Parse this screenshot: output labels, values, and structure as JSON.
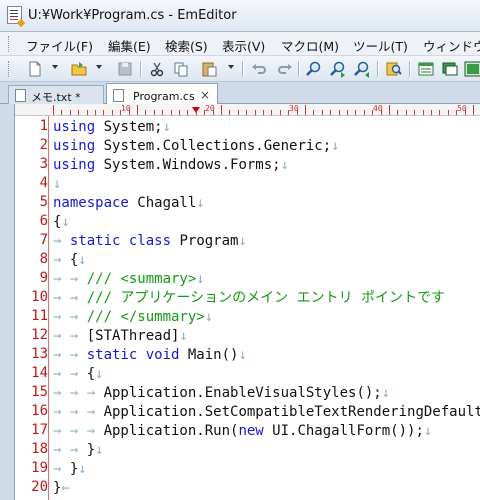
{
  "window": {
    "title": "U:¥Work¥Program.cs - EmEditor"
  },
  "menu": [
    "ファイル(F)",
    "編集(E)",
    "検索(S)",
    "表示(V)",
    "マクロ(M)",
    "ツール(T)",
    "ウィンドウ"
  ],
  "tabs": [
    {
      "label": "メモ.txt *",
      "active": false
    },
    {
      "label": "Program.cs",
      "active": true,
      "close_glyph": "×"
    }
  ],
  "ruler": {
    "labels": [
      "10",
      "20",
      "30",
      "40",
      "50"
    ]
  },
  "editor": {
    "line_numbers": [
      "1",
      "2",
      "3",
      "4",
      "5",
      "6",
      "7",
      "8",
      "9",
      "10",
      "11",
      "12",
      "13",
      "14",
      "15",
      "16",
      "17",
      "18",
      "19",
      "20"
    ],
    "lines": [
      [
        [
          "kw",
          "using"
        ],
        [
          "t",
          " System;"
        ],
        [
          "mk",
          "↓"
        ]
      ],
      [
        [
          "kw",
          "using"
        ],
        [
          "t",
          " System.Collections.Generic;"
        ],
        [
          "mk",
          "↓"
        ]
      ],
      [
        [
          "kw",
          "using"
        ],
        [
          "t",
          " System.Windows.Forms;"
        ],
        [
          "mk",
          "↓"
        ]
      ],
      [
        [
          "mk",
          "↓"
        ]
      ],
      [
        [
          "kw",
          "namespace"
        ],
        [
          "t",
          " Chagall"
        ],
        [
          "mk",
          "↓"
        ]
      ],
      [
        [
          "t",
          "{"
        ],
        [
          "mk",
          "↓"
        ]
      ],
      [
        [
          "mk",
          "→ "
        ],
        [
          "kw",
          "static"
        ],
        [
          "t",
          " "
        ],
        [
          "kw",
          "class"
        ],
        [
          "t",
          " Program"
        ],
        [
          "mk",
          "↓"
        ]
      ],
      [
        [
          "mk",
          "→ "
        ],
        [
          "t",
          "{"
        ],
        [
          "mk",
          "↓"
        ]
      ],
      [
        [
          "mk",
          "→ → "
        ],
        [
          "cm",
          "/// <summary>"
        ],
        [
          "mk",
          "↓"
        ]
      ],
      [
        [
          "mk",
          "→ → "
        ],
        [
          "cm",
          "/// アプリケーションのメイン エントリ ポイントです"
        ]
      ],
      [
        [
          "mk",
          "→ → "
        ],
        [
          "cm",
          "/// </summary>"
        ],
        [
          "mk",
          "↓"
        ]
      ],
      [
        [
          "mk",
          "→ → "
        ],
        [
          "t",
          "[STAThread]"
        ],
        [
          "mk",
          "↓"
        ]
      ],
      [
        [
          "mk",
          "→ → "
        ],
        [
          "kw",
          "static"
        ],
        [
          "t",
          " "
        ],
        [
          "kw",
          "void"
        ],
        [
          "t",
          " Main()"
        ],
        [
          "mk",
          "↓"
        ]
      ],
      [
        [
          "mk",
          "→ → "
        ],
        [
          "t",
          "{"
        ],
        [
          "mk",
          "↓"
        ]
      ],
      [
        [
          "mk",
          "→ → → "
        ],
        [
          "t",
          "Application.EnableVisualStyles();"
        ],
        [
          "mk",
          "↓"
        ]
      ],
      [
        [
          "mk",
          "→ → → "
        ],
        [
          "t",
          "Application.SetCompatibleTextRenderingDefault(fa"
        ]
      ],
      [
        [
          "mk",
          "→ → → "
        ],
        [
          "t",
          "Application.Run("
        ],
        [
          "kw",
          "new"
        ],
        [
          "t",
          " UI.ChagallForm());"
        ],
        [
          "mk",
          "↓"
        ]
      ],
      [
        [
          "mk",
          "→ → "
        ],
        [
          "t",
          "}"
        ],
        [
          "mk",
          "↓"
        ]
      ],
      [
        [
          "mk",
          "→ "
        ],
        [
          "t",
          "}"
        ],
        [
          "mk",
          "↓"
        ]
      ],
      [
        [
          "t",
          "}"
        ],
        [
          "mk",
          "←"
        ]
      ]
    ]
  },
  "colors": {
    "keyword": "#1818d0",
    "comment": "#149a14",
    "line_number": "#c01818",
    "marker": "#8fb0c4"
  }
}
